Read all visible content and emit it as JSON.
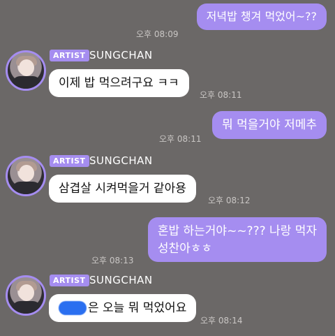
{
  "messages": {
    "m1": {
      "text": "저녁밥 챙겨 먹었어~??",
      "time": "오후 08:09"
    },
    "m2": {
      "badge": "ARTIST",
      "sender": "SUNGCHAN",
      "text": "이제 밥 먹으려구요 ㅋㅋ",
      "time": "오후 08:11"
    },
    "m3": {
      "text": "뭐 먹을거야 저메추",
      "time": "오후 08:11"
    },
    "m4": {
      "badge": "ARTIST",
      "sender": "SUNGCHAN",
      "text": "삼겹살 시켜먹을거 같아용",
      "time": "오후 08:12"
    },
    "m5": {
      "line1": "혼밥 하는거야~~??? 나랑 먹자",
      "line2": "성찬아ㅎㅎ",
      "time": "오후 08:13"
    },
    "m6": {
      "badge": "ARTIST",
      "sender": "SUNGCHAN",
      "text": "은 오늘 뭐 먹었어요",
      "time": "오후 08:14"
    }
  },
  "colors": {
    "background": "#6b6867",
    "accent": "#a58df0",
    "incoming_bubble": "#ffffff"
  }
}
